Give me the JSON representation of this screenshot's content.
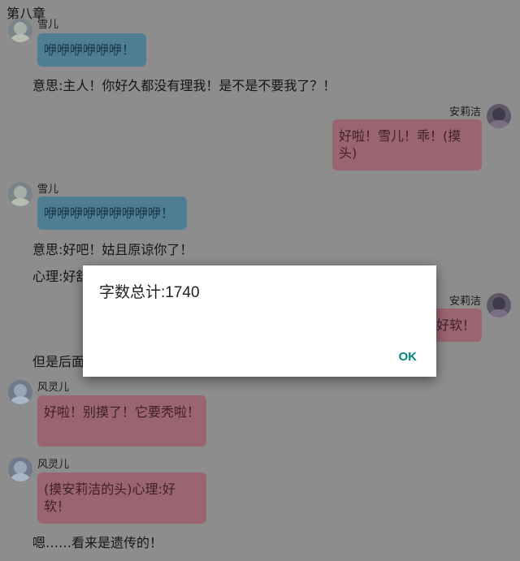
{
  "chapter_title": "第八章",
  "messages": [
    {
      "speaker": "雪儿",
      "text": "咿咿咿咿咿咿！"
    },
    {
      "text": "意思:主人！你好久都没有理我！是不是不要我了？！"
    },
    {
      "speaker": "安莉洁",
      "text": "好啦！雪儿！乖！(摸头)"
    },
    {
      "speaker": "雪儿",
      "text": "咿咿咿咿咿咿咿咿咿！"
    },
    {
      "text": "意思:好吧！姑且原谅你了！"
    },
    {
      "text": "心理:好舒"
    },
    {
      "speaker": "安莉洁",
      "text": "好软！"
    },
    {
      "text": "但是后面"
    },
    {
      "speaker": "风灵儿",
      "text": "好啦！别摸了！它要秃啦！"
    },
    {
      "speaker": "风灵儿",
      "text": "(摸安莉洁的头)心理:好软！"
    },
    {
      "text": "嗯……看来是遗传的！"
    }
  ],
  "dialog": {
    "title": "字数总计:1740",
    "ok_label": "OK"
  },
  "colors": {
    "overlay": "#8d8d8d",
    "blue_bubble": "#4f7e93",
    "pink_bubble": "#9a6570",
    "accent": "#00897b"
  }
}
